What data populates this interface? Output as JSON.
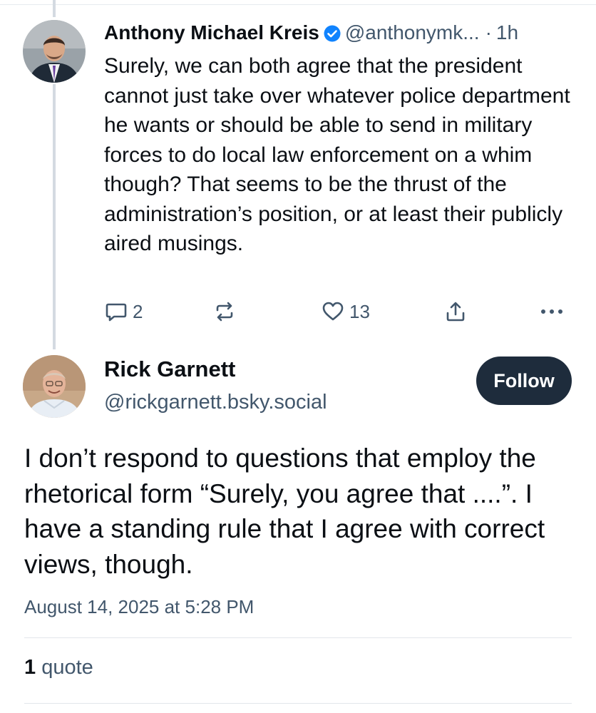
{
  "parent": {
    "author_name": "Anthony Michael Kreis",
    "handle": "@anthonymk...",
    "separator": "·",
    "time": "1h",
    "text": "Surely, we can both agree that the president cannot just take over whatever police department he wants or should be able to send in military forces to do local law enforcement on a whim though? That seems to be the thrust of the administration’s position, or at least their publicly aired musings.",
    "reply_count": "2",
    "like_count": "13",
    "verified_color": "#1083fe"
  },
  "reply": {
    "author_name": "Rick Garnett",
    "handle": "@rickgarnett.bsky.social",
    "follow_label": "Follow",
    "text": "I don’t respond to questions that employ the rhetorical form “Surely, you agree that ....”. I have a standing rule that I agree with correct views, though.",
    "timestamp": "August 14, 2025 at 5:28 PM",
    "quote_count": "1",
    "quote_label": "quote"
  },
  "colors": {
    "text_primary": "#0b0f14",
    "text_secondary": "#42576c",
    "follow_bg": "#1e2c3c",
    "thread_line": "#d4dae1"
  },
  "icons": [
    "reply-icon",
    "repost-icon",
    "like-icon",
    "share-icon",
    "more-icon",
    "verified-check-icon"
  ]
}
